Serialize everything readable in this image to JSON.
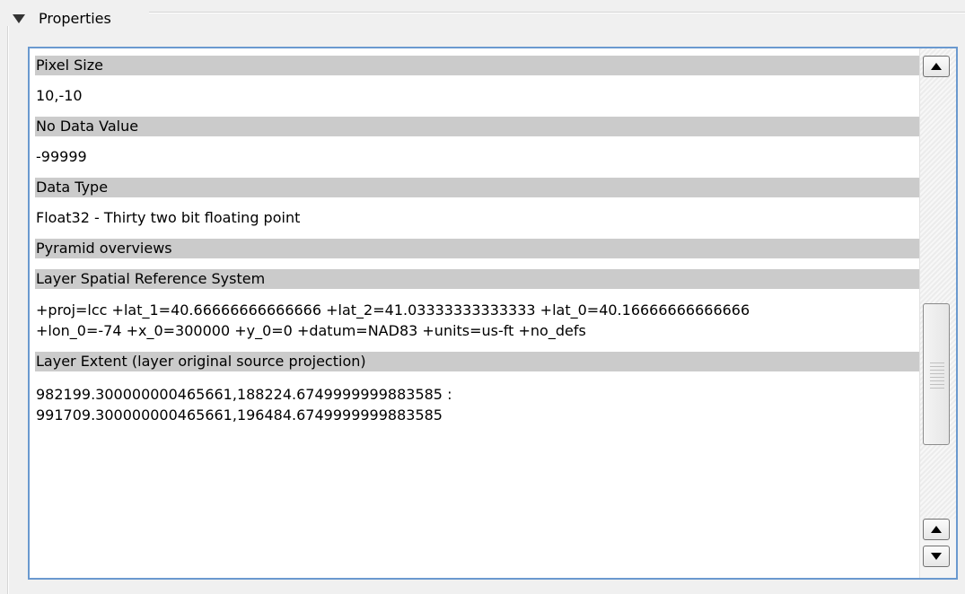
{
  "group": {
    "title": "Properties"
  },
  "sections": [
    {
      "heading": "Pixel Size",
      "body": [
        "10,-10"
      ]
    },
    {
      "heading": "No Data Value",
      "body": [
        "-99999"
      ]
    },
    {
      "heading": "Data Type",
      "body": [
        "Float32 - Thirty two bit floating point"
      ]
    },
    {
      "heading": "Pyramid overviews",
      "body": []
    },
    {
      "heading": "Layer Spatial Reference System",
      "body": [
        "+proj=lcc +lat_1=40.66666666666666 +lat_2=41.03333333333333 +lat_0=40.16666666666666",
        "+lon_0=-74 +x_0=300000 +y_0=0 +datum=NAD83 +units=us-ft +no_defs"
      ]
    },
    {
      "heading": "Layer Extent (layer original source projection)",
      "body": [
        "982199.300000000465661,188224.6749999999883585 :",
        "991709.300000000465661,196484.6749999999883585"
      ]
    }
  ]
}
